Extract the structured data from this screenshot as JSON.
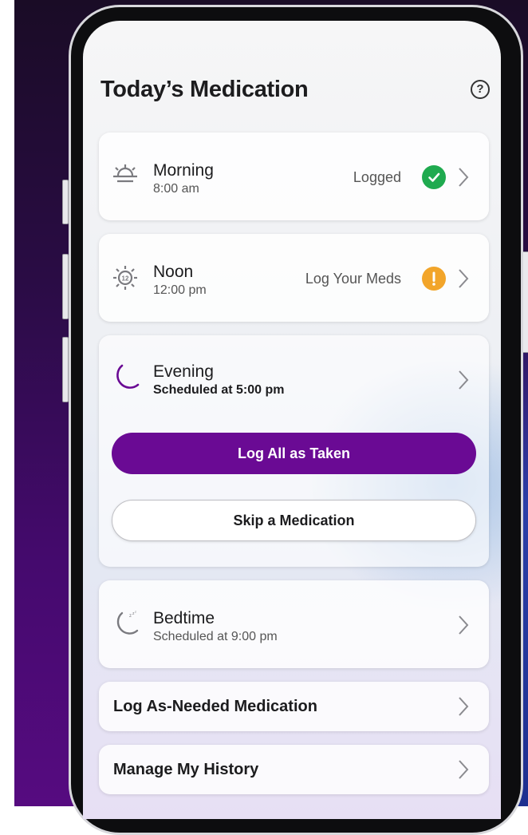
{
  "header": {
    "title": "Today’s Medication",
    "help_icon": "question-icon"
  },
  "slots": [
    {
      "title": "Morning",
      "time": "8:00 am",
      "status": "Logged",
      "badge_icon": "check-icon",
      "badge_color": "#1faa4f"
    },
    {
      "title": "Noon",
      "time": "12:00 pm",
      "status": "Log Your Meds",
      "badge_icon": "exclamation-icon",
      "badge_color": "#f2a52a"
    },
    {
      "title": "Evening",
      "time": "Scheduled at 5:00 pm",
      "primary_action": "Log All as Taken",
      "secondary_action": "Skip a Medication"
    },
    {
      "title": "Bedtime",
      "time": "Scheduled at 9:00 pm"
    }
  ],
  "links": [
    {
      "label": "Log As-Needed Medication"
    },
    {
      "label": "Manage My History"
    }
  ],
  "colors": {
    "accent": "#6a0a94",
    "success": "#1faa4f",
    "warning": "#f2a52a"
  }
}
